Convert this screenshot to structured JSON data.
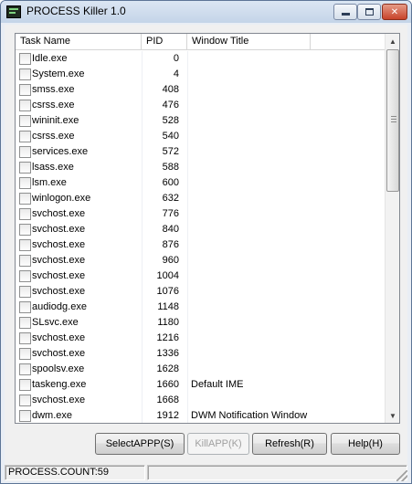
{
  "window": {
    "title": "PROCESS Killer 1.0"
  },
  "listview": {
    "columns": [
      {
        "label": "Task Name"
      },
      {
        "label": "PID"
      },
      {
        "label": "Window Title"
      }
    ],
    "rows": [
      {
        "name": "Idle.exe",
        "pid": "0",
        "window": ""
      },
      {
        "name": "System.exe",
        "pid": "4",
        "window": ""
      },
      {
        "name": "smss.exe",
        "pid": "408",
        "window": ""
      },
      {
        "name": "csrss.exe",
        "pid": "476",
        "window": ""
      },
      {
        "name": "wininit.exe",
        "pid": "528",
        "window": ""
      },
      {
        "name": "csrss.exe",
        "pid": "540",
        "window": ""
      },
      {
        "name": "services.exe",
        "pid": "572",
        "window": ""
      },
      {
        "name": "lsass.exe",
        "pid": "588",
        "window": ""
      },
      {
        "name": "lsm.exe",
        "pid": "600",
        "window": ""
      },
      {
        "name": "winlogon.exe",
        "pid": "632",
        "window": ""
      },
      {
        "name": "svchost.exe",
        "pid": "776",
        "window": ""
      },
      {
        "name": "svchost.exe",
        "pid": "840",
        "window": ""
      },
      {
        "name": "svchost.exe",
        "pid": "876",
        "window": ""
      },
      {
        "name": "svchost.exe",
        "pid": "960",
        "window": ""
      },
      {
        "name": "svchost.exe",
        "pid": "1004",
        "window": ""
      },
      {
        "name": "svchost.exe",
        "pid": "1076",
        "window": ""
      },
      {
        "name": "audiodg.exe",
        "pid": "1148",
        "window": ""
      },
      {
        "name": "SLsvc.exe",
        "pid": "1180",
        "window": ""
      },
      {
        "name": "svchost.exe",
        "pid": "1216",
        "window": ""
      },
      {
        "name": "svchost.exe",
        "pid": "1336",
        "window": ""
      },
      {
        "name": "spoolsv.exe",
        "pid": "1628",
        "window": ""
      },
      {
        "name": "taskeng.exe",
        "pid": "1660",
        "window": "Default IME"
      },
      {
        "name": "svchost.exe",
        "pid": "1668",
        "window": ""
      },
      {
        "name": "dwm.exe",
        "pid": "1912",
        "window": "DWM Notification Window"
      }
    ]
  },
  "buttons": {
    "select": "SelectAPPP(S)",
    "kill": "KillAPP(K)",
    "refresh": "Refresh(R)",
    "help": "Help(H)"
  },
  "status": {
    "count": "PROCESS.COUNT:59"
  },
  "icons": {
    "app": "app-icon",
    "minimize": "minimize-icon",
    "maximize": "maximize-icon",
    "close": "close-icon",
    "scroll_up": "scroll-up-arrow-icon",
    "scroll_down": "scroll-down-arrow-icon"
  },
  "colors": {
    "close_button": "#c8432a",
    "window_frame": "#5d7596"
  }
}
